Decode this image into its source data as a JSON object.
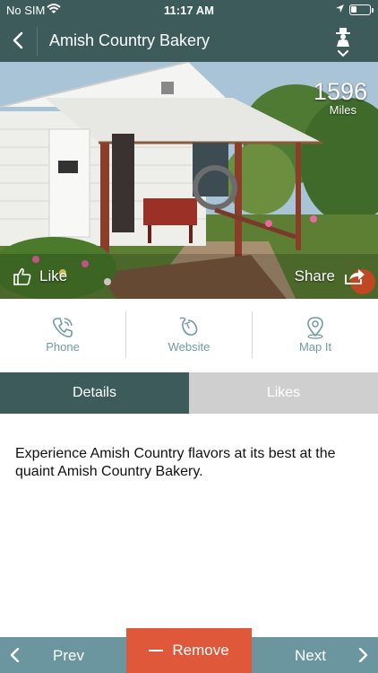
{
  "status_bar": {
    "carrier": "No SIM",
    "time": "11:17 AM",
    "battery_level": 0.25
  },
  "nav": {
    "title": "Amish Country Bakery"
  },
  "hero": {
    "distance_value": "1596",
    "distance_unit": "Miles",
    "like_label": "Like",
    "share_label": "Share"
  },
  "actions": {
    "phone_label": "Phone",
    "website_label": "Website",
    "map_label": "Map It"
  },
  "tabs": {
    "details_label": "Details",
    "likes_label": "Likes",
    "active": "Details"
  },
  "details": {
    "description": "Experience Amish Country flavors at its best at the quaint Amish Country Bakery."
  },
  "bottom_bar": {
    "prev_label": "Prev",
    "remove_label": "Remove",
    "next_label": "Next"
  },
  "colors": {
    "header": "#3e5b5c",
    "accent": "#6f9aa3",
    "bottom_bar": "#6b96a0",
    "remove": "#e0583a",
    "inactive_tab": "#cfcfcf"
  },
  "icons": [
    "wifi-icon",
    "location-arrow-icon",
    "battery-icon",
    "back-chevron-icon",
    "amish-person-icon",
    "chevron-down-icon",
    "thumbs-up-icon",
    "share-icon",
    "phone-icon",
    "mouse-icon",
    "map-pin-icon",
    "chevron-left-icon",
    "minus-icon",
    "chevron-right-icon"
  ]
}
